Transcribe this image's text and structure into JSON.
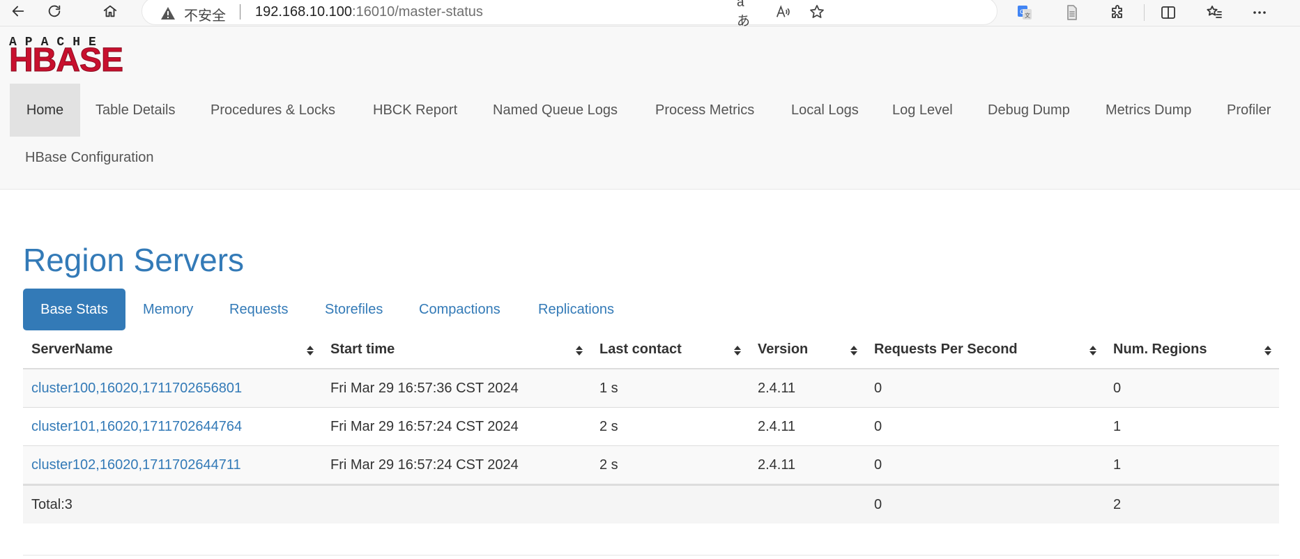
{
  "browser": {
    "security_label": "不安全",
    "url_host": "192.168.10.100",
    "url_path": ":16010/master-status"
  },
  "logo": {
    "sub": "APACHE",
    "main": "HBASE"
  },
  "nav": {
    "items": [
      "Home",
      "Table Details",
      "Procedures & Locks",
      "HBCK Report",
      "Named Queue Logs",
      "Process Metrics",
      "Local Logs",
      "Log Level",
      "Debug Dump",
      "Metrics Dump",
      "Profiler",
      "HBase Configuration"
    ]
  },
  "region_servers": {
    "title": "Region Servers",
    "tabs": [
      "Base Stats",
      "Memory",
      "Requests",
      "Storefiles",
      "Compactions",
      "Replications"
    ],
    "columns": [
      "ServerName",
      "Start time",
      "Last contact",
      "Version",
      "Requests Per Second",
      "Num. Regions"
    ],
    "rows": [
      [
        "cluster100,16020,1711702656801",
        "Fri Mar 29 16:57:36 CST 2024",
        "1 s",
        "2.4.11",
        "0",
        "0"
      ],
      [
        "cluster101,16020,1711702644764",
        "Fri Mar 29 16:57:24 CST 2024",
        "2 s",
        "2.4.11",
        "0",
        "1"
      ],
      [
        "cluster102,16020,1711702644711",
        "Fri Mar 29 16:57:24 CST 2024",
        "2 s",
        "2.4.11",
        "0",
        "1"
      ]
    ],
    "total": {
      "label": "Total:3",
      "requests": "0",
      "regions": "2"
    }
  },
  "colors": {
    "link": "#337ab7",
    "logo_red": "#c8102e",
    "active_tab": "#337ab7"
  }
}
